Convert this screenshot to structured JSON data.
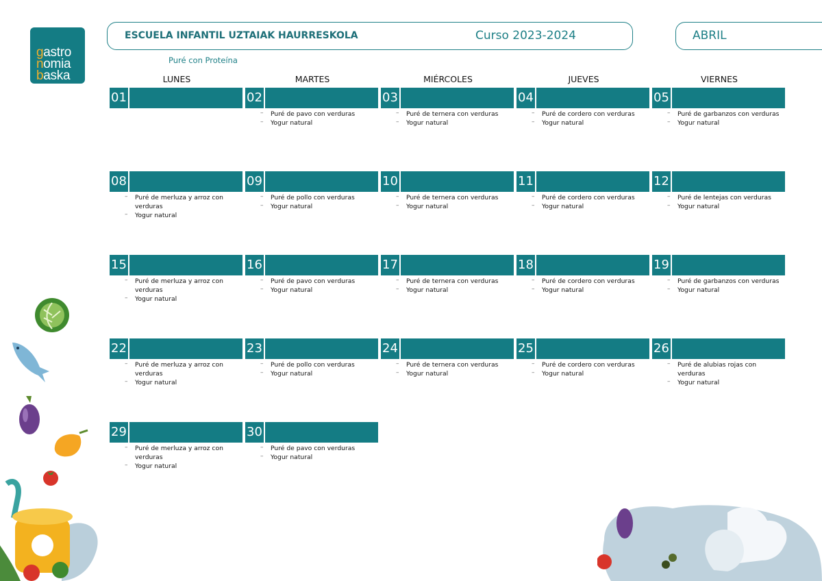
{
  "logo": {
    "lines": [
      "gastro",
      "nomia",
      "baska"
    ]
  },
  "header": {
    "school": "ESCUELA INFANTIL UZTAIAK HAURRESKOLA",
    "course": "Curso 2023-2024",
    "month": "ABRIL"
  },
  "subtitle": "Puré con Proteína",
  "days": [
    "LUNES",
    "MARTES",
    "MIÉRCOLES",
    "JUEVES",
    "VIERNES"
  ],
  "weeks": [
    [
      {
        "day": "01",
        "items": []
      },
      {
        "day": "02",
        "items": [
          "Puré de pavo con verduras",
          "Yogur natural"
        ]
      },
      {
        "day": "03",
        "items": [
          "Puré de ternera con verduras",
          "Yogur natural"
        ]
      },
      {
        "day": "04",
        "items": [
          "Puré de cordero con verduras",
          "Yogur natural"
        ]
      },
      {
        "day": "05",
        "items": [
          "Puré de garbanzos con verduras",
          "Yogur natural"
        ]
      }
    ],
    [
      {
        "day": "08",
        "items": [
          "Puré de merluza y arroz con verduras",
          "Yogur natural"
        ]
      },
      {
        "day": "09",
        "items": [
          "Puré de pollo con verduras",
          "Yogur natural"
        ]
      },
      {
        "day": "10",
        "items": [
          "Puré de ternera con verduras",
          "Yogur natural"
        ]
      },
      {
        "day": "11",
        "items": [
          "Puré de cordero con verduras",
          "Yogur natural"
        ]
      },
      {
        "day": "12",
        "items": [
          "Puré de lentejas con verduras",
          "Yogur natural"
        ]
      }
    ],
    [
      {
        "day": "15",
        "items": [
          "Puré de merluza y arroz con verduras",
          "Yogur natural"
        ]
      },
      {
        "day": "16",
        "items": [
          "Puré de pavo con verduras",
          "Yogur natural"
        ]
      },
      {
        "day": "17",
        "items": [
          "Puré de ternera con verduras",
          "Yogur natural"
        ]
      },
      {
        "day": "18",
        "items": [
          "Puré de cordero con verduras",
          "Yogur natural"
        ]
      },
      {
        "day": "19",
        "items": [
          "Puré de garbanzos con verduras",
          "Yogur natural"
        ]
      }
    ],
    [
      {
        "day": "22",
        "items": [
          "Puré de merluza y arroz con verduras",
          "Yogur natural"
        ]
      },
      {
        "day": "23",
        "items": [
          "Puré de pollo con verduras",
          "Yogur natural"
        ]
      },
      {
        "day": "24",
        "items": [
          "Puré de ternera con verduras",
          "Yogur natural"
        ]
      },
      {
        "day": "25",
        "items": [
          "Puré de cordero con verduras",
          "Yogur natural"
        ]
      },
      {
        "day": "26",
        "items": [
          "Puré de alubias rojas con verduras",
          "Yogur natural"
        ]
      }
    ],
    [
      {
        "day": "29",
        "items": [
          "Puré de merluza y arroz con verduras",
          "Yogur natural"
        ]
      },
      {
        "day": "30",
        "items": [
          "Puré de pavo con verduras",
          "Yogur natural"
        ]
      }
    ]
  ],
  "colors": {
    "accent": "#147c84",
    "border": "#1d7f86"
  },
  "decorations": [
    "lettuce-icon",
    "fish-icon",
    "eggplant-icon",
    "pepper-icon",
    "tomato-icon",
    "cooking-pot-icon",
    "chef-hat-icon",
    "olives-icon"
  ]
}
